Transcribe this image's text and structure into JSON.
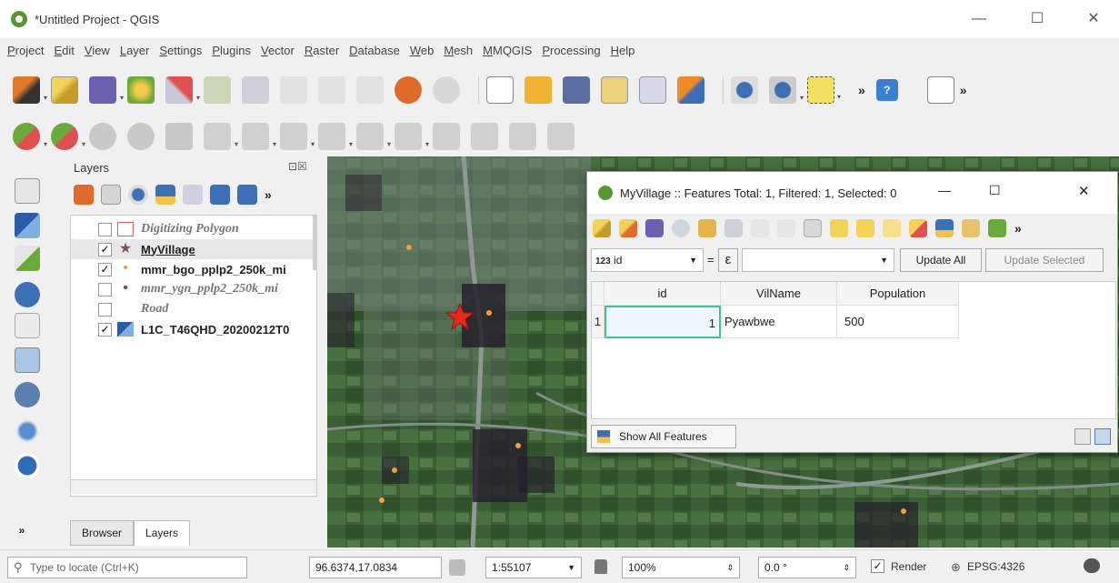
{
  "window": {
    "title": "*Untitled Project - QGIS",
    "minimize_glyph": "—",
    "maximize_glyph": "☐",
    "close_glyph": "✕"
  },
  "menu": [
    "Project",
    "Edit",
    "View",
    "Layer",
    "Settings",
    "Plugins",
    "Vector",
    "Raster",
    "Database",
    "Web",
    "Mesh",
    "MMQGIS",
    "Processing",
    "Help"
  ],
  "toolbar": {
    "overflow_glyph": "»",
    "help_glyph": "?"
  },
  "layers_panel": {
    "title": "Layers",
    "close_glyph": "⊡☒",
    "overflow_glyph": "»",
    "layers": [
      {
        "name": "Digitizing Polygon",
        "checked": false,
        "style": "italic",
        "check_glyph": ""
      },
      {
        "name": "MyVillage",
        "checked": true,
        "style": "bold-underline",
        "check_glyph": "✓"
      },
      {
        "name": "mmr_bgo_pplp2_250k_mi",
        "checked": true,
        "style": "bold",
        "check_glyph": "✓"
      },
      {
        "name": "mmr_ygn_pplp2_250k_mi",
        "checked": false,
        "style": "italic",
        "check_glyph": ""
      },
      {
        "name": "Road",
        "checked": false,
        "style": "italic",
        "check_glyph": ""
      },
      {
        "name": "L1C_T46QHD_20200212T0",
        "checked": true,
        "style": "bold",
        "check_glyph": "✓"
      }
    ],
    "tabs": [
      "Browser",
      "Layers"
    ],
    "active_tab": "Layers"
  },
  "attribute_table": {
    "title": "MyVillage :: Features Total: 1, Filtered: 1, Selected: 0",
    "minimize_glyph": "—",
    "maximize_glyph": "☐",
    "close_glyph": "✕",
    "overflow_glyph": "»",
    "field_select": "id",
    "field_type_prefix": "123",
    "equals": "=",
    "epsilon_glyph": "ε",
    "update_all_label": "Update All",
    "update_selected_label": "Update Selected",
    "columns": [
      "id",
      "VilName",
      "Population"
    ],
    "rows": [
      {
        "row_number": "1",
        "id": "1",
        "VilName": "Pyawbwe",
        "Population": "500"
      }
    ],
    "show_all_label": "Show All Features"
  },
  "status_bar": {
    "search_placeholder": "Type to locate (Ctrl+K)",
    "coordinate_label": "",
    "coordinate_value": "96.6374,17.0834",
    "scale_label": "",
    "scale_value": "1:55107",
    "magnifier_label": "",
    "magnifier_value": "100%",
    "rotation_label": "",
    "rotation_value": "0.0 °",
    "render_label": "Render",
    "crs_label": "EPSG:4326"
  },
  "colors": {
    "qgis_green": "#589632",
    "star_red": "#e8281e",
    "selection_cell_border": "#3cc88c"
  }
}
